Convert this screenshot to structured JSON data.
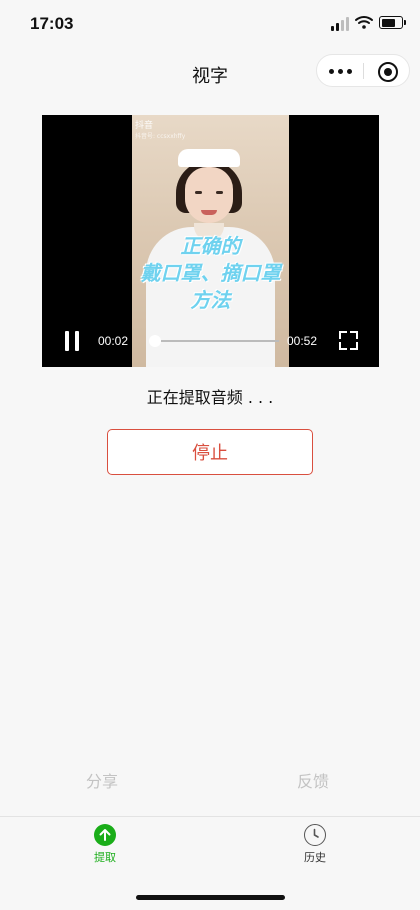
{
  "status_bar": {
    "time": "17:03"
  },
  "nav": {
    "title": "视字"
  },
  "video": {
    "watermark": "抖音",
    "watermark_sub": "抖音号: ccsxxhffy",
    "overlay_lines": [
      "正确的",
      "戴口罩、摘口罩",
      "方法"
    ],
    "current_time": "00:02",
    "total_time": "00:52",
    "progress": 0.04
  },
  "status_text": "正在提取音频 . . .",
  "stop_label": "停止",
  "actions": {
    "share_label": "分享",
    "feedback_label": "反馈"
  },
  "tabbar": {
    "items": [
      {
        "label": "提取",
        "active": true
      },
      {
        "label": "历史",
        "active": false
      }
    ]
  },
  "colors": {
    "accent": "#1aad19",
    "danger": "#d94f3f",
    "muted": "#c3c3c3",
    "overlay_text": "#6fd2ef"
  }
}
